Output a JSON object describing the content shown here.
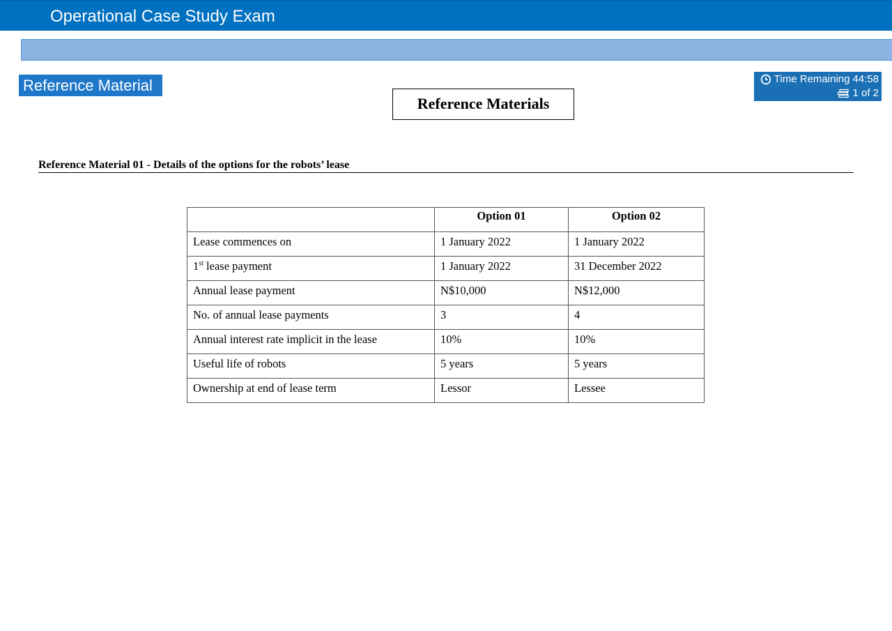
{
  "app": {
    "title": "Operational Case Study Exam"
  },
  "toolbar": {
    "reference_button_label": "Reference Material"
  },
  "status": {
    "time_label": "Time Remaining",
    "time_value": "44:58",
    "page_indicator": "1 of 2"
  },
  "document": {
    "heading": "Reference Materials",
    "section_title": "Reference Material 01 - Details of the options for the robots’ lease",
    "table": {
      "headers": [
        "",
        "Option 01",
        "Option 02"
      ],
      "rows": [
        {
          "label_main": "Lease commences on",
          "option01": "1 January 2022",
          "option02": "1 January 2022"
        },
        {
          "label_prefix": "1",
          "label_sup": "st",
          "label_main": " lease payment",
          "option01": "1 January 2022",
          "option02": "31 December 2022"
        },
        {
          "label_main": "Annual lease payment",
          "option01": "N$10,000",
          "option02": "N$12,000"
        },
        {
          "label_main": "No. of annual lease payments",
          "option01": "3",
          "option02": "4"
        },
        {
          "label_main": "Annual interest rate implicit in the lease",
          "option01": "10%",
          "option02": "10%"
        },
        {
          "label_main": "Useful life of robots",
          "option01": "5 years",
          "option02": "5 years"
        },
        {
          "label_main": "Ownership at end of lease term",
          "option01": "Lessor",
          "option02": "Lessee"
        }
      ]
    }
  },
  "icons": {
    "timer": "clock-icon",
    "pages": "pages-icon"
  },
  "colors": {
    "title_bar": "#0070c0",
    "toolbar_strip": "#8db3e2",
    "reference_button": "#1f77c9",
    "timer_box": "#1a6fb5"
  }
}
